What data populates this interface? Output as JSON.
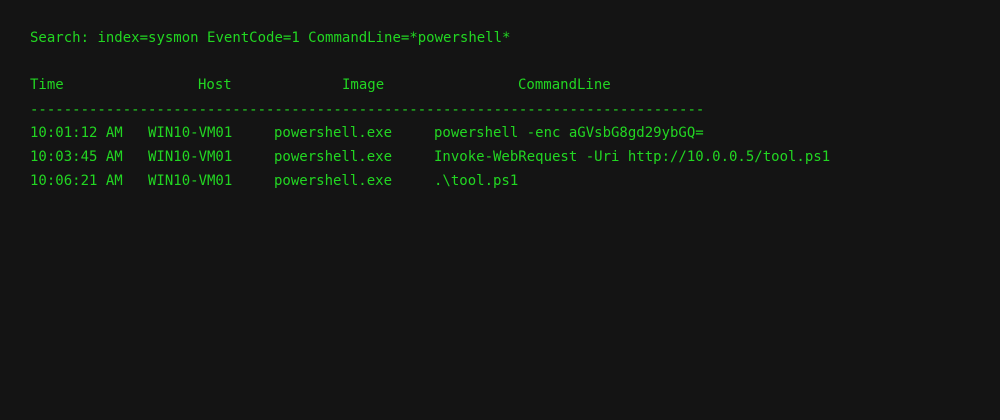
{
  "search": {
    "label": "Search:",
    "query": "index=sysmon EventCode=1 CommandLine=*powershell*"
  },
  "table": {
    "columns": [
      "Time",
      "Host",
      "Image",
      "CommandLine"
    ],
    "divider": "--------------------------------------------------------------------------------",
    "rows": [
      {
        "time": "10:01:12 AM",
        "host": "WIN10-VM01",
        "image": "powershell.exe",
        "commandline": "powershell -enc aGVsbG8gd29ybGQ="
      },
      {
        "time": "10:03:45 AM",
        "host": "WIN10-VM01",
        "image": "powershell.exe",
        "commandline": "Invoke-WebRequest -Uri http://10.0.0.5/tool.ps1"
      },
      {
        "time": "10:06:21 AM",
        "host": "WIN10-VM01",
        "image": "powershell.exe",
        "commandline": ".\\tool.ps1"
      }
    ]
  }
}
